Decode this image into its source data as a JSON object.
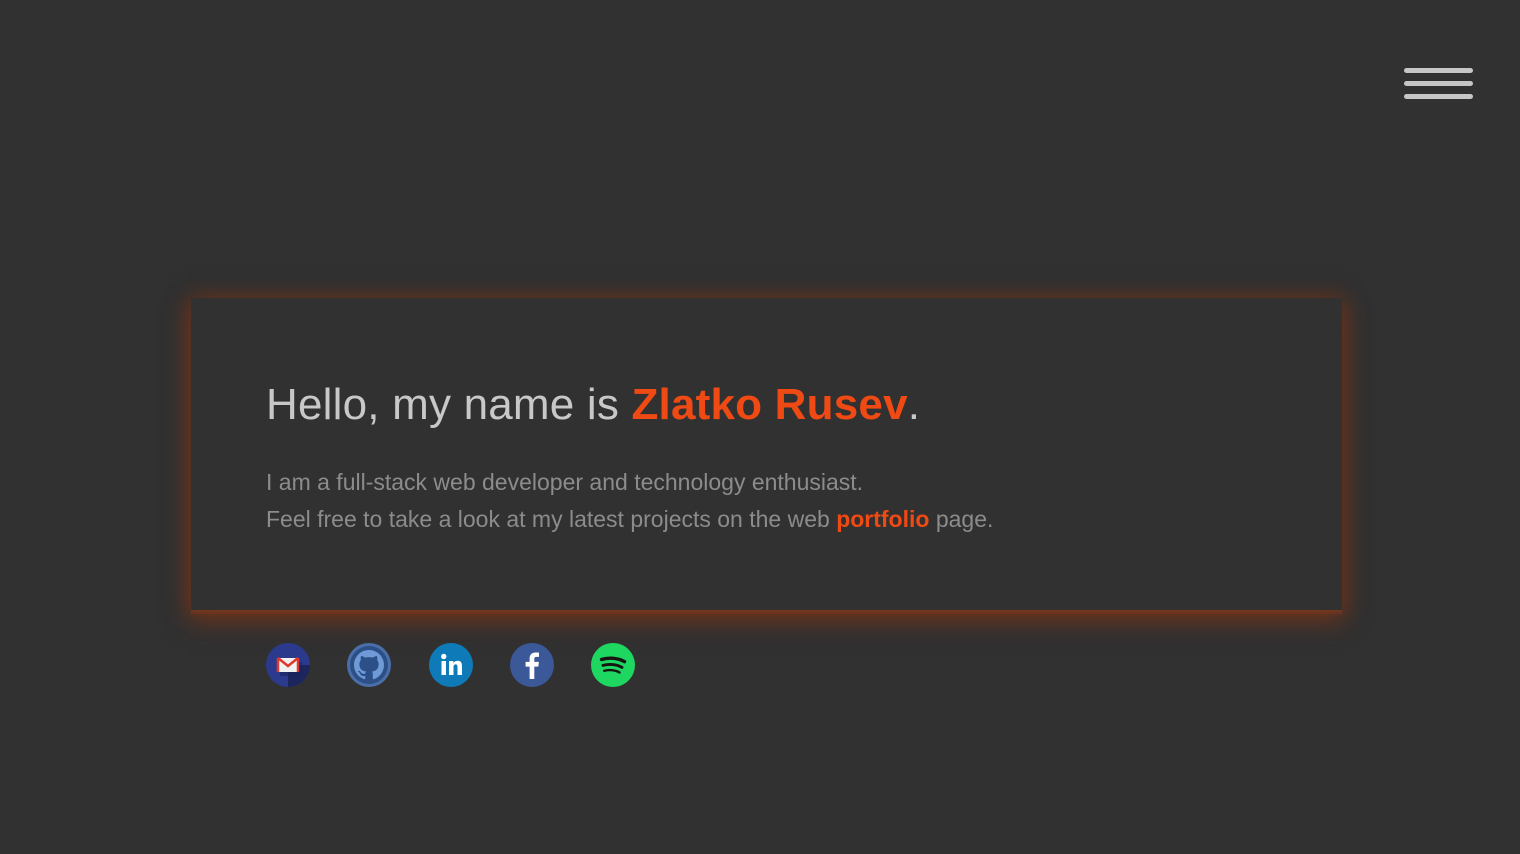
{
  "nav": {
    "menu_icon": "hamburger-menu-icon"
  },
  "hero": {
    "greeting_prefix": "Hello, my name is ",
    "name": "Zlatko Rusev",
    "greeting_suffix": ".",
    "line1": "I am a full-stack web developer and technology enthusiast.",
    "line2_prefix": "Feel free to take a look at my latest projects on the web ",
    "portfolio_link": "portfolio",
    "line2_suffix": " page."
  },
  "social": {
    "icons": [
      "gmail-icon",
      "github-icon",
      "linkedin-icon",
      "facebook-icon",
      "spotify-icon"
    ]
  },
  "colors": {
    "background": "#313131",
    "accent": "#f04a14",
    "heading_text": "#c8c8c8",
    "body_text": "#8c8c8c",
    "glow": "#8a3a1a",
    "gmail_bg": "#2b3a8c",
    "github_bg": "#4a6fa8",
    "linkedin_bg": "#0e7ab8",
    "facebook_bg": "#3b5998",
    "spotify_bg": "#1ed760"
  }
}
